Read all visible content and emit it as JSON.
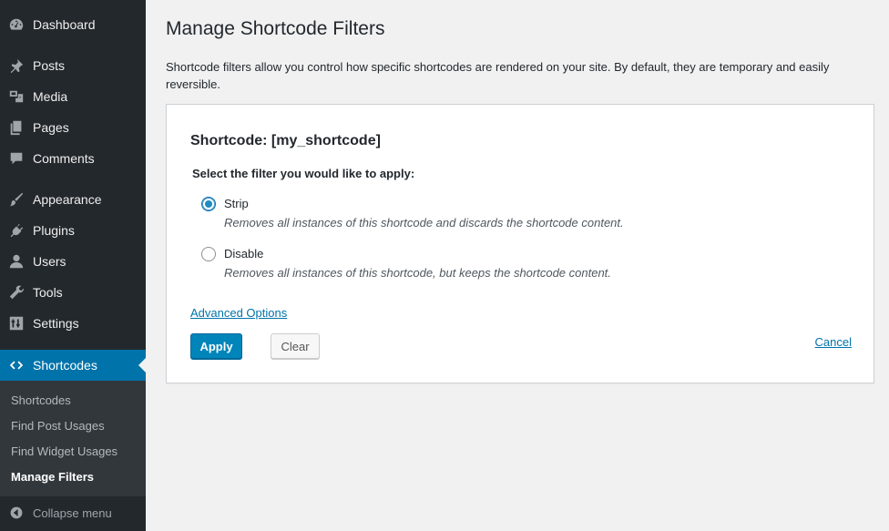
{
  "sidebar": {
    "items": [
      {
        "label": "Dashboard",
        "icon": "dashboard-icon"
      },
      {
        "label": "Posts",
        "icon": "pin-icon"
      },
      {
        "label": "Media",
        "icon": "media-icon"
      },
      {
        "label": "Pages",
        "icon": "pages-icon"
      },
      {
        "label": "Comments",
        "icon": "comment-icon"
      },
      {
        "label": "Appearance",
        "icon": "brush-icon"
      },
      {
        "label": "Plugins",
        "icon": "plugin-icon"
      },
      {
        "label": "Users",
        "icon": "user-icon"
      },
      {
        "label": "Tools",
        "icon": "wrench-icon"
      },
      {
        "label": "Settings",
        "icon": "settings-icon"
      },
      {
        "label": "Shortcodes",
        "icon": "code-icon"
      }
    ],
    "submenu": [
      {
        "label": "Shortcodes"
      },
      {
        "label": "Find Post Usages"
      },
      {
        "label": "Find Widget Usages"
      },
      {
        "label": "Manage Filters"
      }
    ],
    "collapse_label": "Collapse menu"
  },
  "main": {
    "title": "Manage Shortcode Filters",
    "intro": "Shortcode filters allow you control how specific shortcodes are rendered on your site. By default, they are temporary and easily reversible.",
    "panel": {
      "shortcode_title": "Shortcode: [my_shortcode]",
      "prompt": "Select the filter you would like to apply:",
      "options": [
        {
          "label": "Strip",
          "description": "Removes all instances of this shortcode and discards the shortcode content.",
          "checked": true
        },
        {
          "label": "Disable",
          "description": "Removes all instances of this shortcode, but keeps the shortcode content.",
          "checked": false
        }
      ],
      "advanced_link": "Advanced Options",
      "apply_label": "Apply",
      "clear_label": "Clear",
      "cancel_label": "Cancel"
    }
  },
  "colors": {
    "sidebar_bg": "#23282d",
    "accent": "#0073aa",
    "button_primary": "#0085ba"
  }
}
